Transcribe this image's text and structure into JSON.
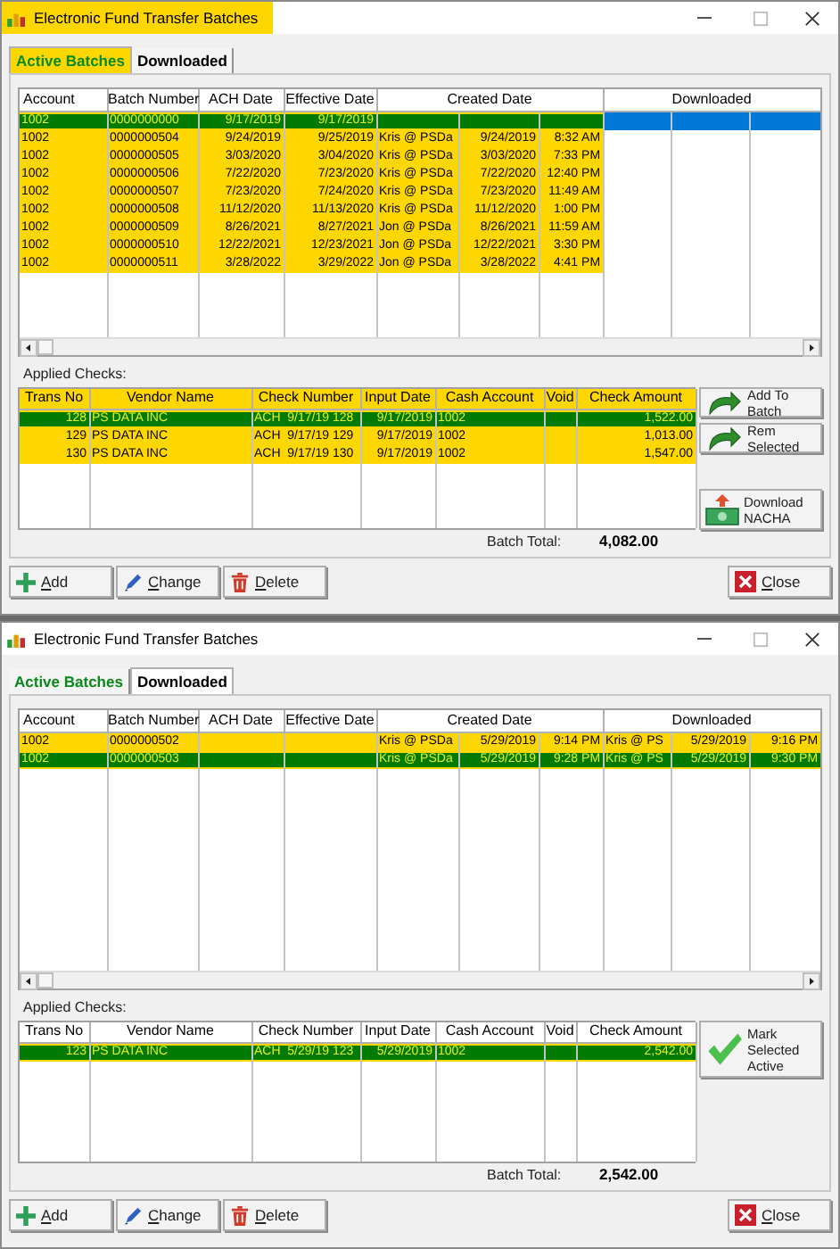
{
  "windows": [
    {
      "title": "Electronic Fund Transfer Batches",
      "title_highlighted": true,
      "tabs": [
        {
          "label": "Active Batches",
          "selected": true,
          "highlighted": true
        },
        {
          "label": "Downloaded",
          "selected": false,
          "highlighted": false
        }
      ],
      "batches": {
        "columns": [
          "Account",
          "Batch Number",
          "ACH Date",
          "Effective Date",
          "Created Date",
          "Downloaded"
        ],
        "rows": [
          {
            "selected": true,
            "highlighted": true,
            "account": "1002",
            "batch_number": "0000000000",
            "ach_date": "9/17/2019",
            "effective_date": "9/17/2019"
          },
          {
            "selected": false,
            "highlighted": true,
            "account": "1002",
            "batch_number": "0000000504",
            "ach_date": "9/24/2019",
            "effective_date": "9/25/2019",
            "created_by": "Kris @ PSDa",
            "created_date": "9/24/2019",
            "created_time": "8:32 AM"
          },
          {
            "selected": false,
            "highlighted": true,
            "account": "1002",
            "batch_number": "0000000505",
            "ach_date": "3/03/2020",
            "effective_date": "3/04/2020",
            "created_by": "Kris @ PSDa",
            "created_date": "3/03/2020",
            "created_time": "7:33 PM"
          },
          {
            "selected": false,
            "highlighted": true,
            "account": "1002",
            "batch_number": "0000000506",
            "ach_date": "7/22/2020",
            "effective_date": "7/23/2020",
            "created_by": "Kris @ PSDa",
            "created_date": "7/22/2020",
            "created_time": "12:40 PM"
          },
          {
            "selected": false,
            "highlighted": true,
            "account": "1002",
            "batch_number": "0000000507",
            "ach_date": "7/23/2020",
            "effective_date": "7/24/2020",
            "created_by": "Kris @ PSDa",
            "created_date": "7/23/2020",
            "created_time": "11:49 AM"
          },
          {
            "selected": false,
            "highlighted": true,
            "account": "1002",
            "batch_number": "0000000508",
            "ach_date": "11/12/2020",
            "effective_date": "11/13/2020",
            "created_by": "Kris @ PSDa",
            "created_date": "11/12/2020",
            "created_time": "1:00 PM"
          },
          {
            "selected": false,
            "highlighted": true,
            "account": "1002",
            "batch_number": "0000000509",
            "ach_date": "8/26/2021",
            "effective_date": "8/27/2021",
            "created_by": "Jon @ PSDa",
            "created_date": "8/26/2021",
            "created_time": "11:59 AM"
          },
          {
            "selected": false,
            "highlighted": true,
            "account": "1002",
            "batch_number": "0000000510",
            "ach_date": "12/22/2021",
            "effective_date": "12/23/2021",
            "created_by": "Jon @ PSDa",
            "created_date": "12/22/2021",
            "created_time": "3:30 PM"
          },
          {
            "selected": false,
            "highlighted": true,
            "account": "1002",
            "batch_number": "0000000511",
            "ach_date": "3/28/2022",
            "effective_date": "3/29/2022",
            "created_by": "Jon @ PSDa",
            "created_date": "3/28/2022",
            "created_time": "4:41 PM"
          }
        ]
      },
      "applied_checks": {
        "label": "Applied Checks:",
        "header_highlighted": true,
        "columns": [
          "Trans No",
          "Vendor Name",
          "Check Number",
          "Input Date",
          "Cash Account",
          "Void",
          "Check Amount"
        ],
        "rows": [
          {
            "selected": true,
            "highlighted": true,
            "trans_no": "128",
            "vendor": "PS DATA INC",
            "check_number": "ACH  9/17/19 128",
            "input_date": "9/17/2019",
            "cash_account": "1002",
            "amount": "1,522.00"
          },
          {
            "selected": false,
            "highlighted": true,
            "trans_no": "129",
            "vendor": "PS DATA INC",
            "check_number": "ACH  9/17/19 129",
            "input_date": "9/17/2019",
            "cash_account": "1002",
            "amount": "1,013.00"
          },
          {
            "selected": false,
            "highlighted": true,
            "trans_no": "130",
            "vendor": "PS DATA INC",
            "check_number": "ACH  9/17/19 130",
            "input_date": "9/17/2019",
            "cash_account": "1002",
            "amount": "1,547.00"
          }
        ]
      },
      "side_buttons": [
        {
          "label": "Add To Batch",
          "kind": "add"
        },
        {
          "label": "Rem Selected",
          "kind": "remove"
        },
        {
          "label": "Download NACHA",
          "kind": "download"
        }
      ],
      "batch_total": {
        "label": "Batch Total:",
        "value": "4,082.00"
      },
      "buttons": [
        {
          "label": "Add",
          "kind": "add"
        },
        {
          "label": "Change",
          "kind": "change"
        },
        {
          "label": "Delete",
          "kind": "delete"
        },
        {
          "label": "Close",
          "kind": "close"
        }
      ]
    },
    {
      "title": "Electronic Fund Transfer Batches",
      "title_highlighted": false,
      "tabs": [
        {
          "label": "Active Batches",
          "selected": false,
          "highlighted": false
        },
        {
          "label": "Downloaded",
          "selected": true,
          "highlighted": false
        }
      ],
      "batches": {
        "columns": [
          "Account",
          "Batch Number",
          "ACH Date",
          "Effective Date",
          "Created Date",
          "Downloaded"
        ],
        "rows": [
          {
            "selected": false,
            "highlighted": true,
            "account": "1002",
            "batch_number": "0000000502",
            "created_by": "Kris @ PSDa",
            "created_date": "5/29/2019",
            "created_time": "9:14 PM",
            "downloaded_by": "Kris @ PS",
            "downloaded_date": "5/29/2019",
            "downloaded_time": "9:16 PM"
          },
          {
            "selected": true,
            "highlighted": true,
            "account": "1002",
            "batch_number": "0000000503",
            "created_by": "Kris @ PSDa",
            "created_date": "5/29/2019",
            "created_time": "9:28 PM",
            "downloaded_by": "Kris @ PS",
            "downloaded_date": "5/29/2019",
            "downloaded_time": "9:30 PM"
          }
        ]
      },
      "applied_checks": {
        "label": "Applied Checks:",
        "header_highlighted": false,
        "columns": [
          "Trans No",
          "Vendor Name",
          "Check Number",
          "Input Date",
          "Cash Account",
          "Void",
          "Check Amount"
        ],
        "rows": [
          {
            "selected": true,
            "highlighted": true,
            "trans_no": "123",
            "vendor": "PS DATA INC",
            "check_number": "ACH  5/29/19 123",
            "input_date": "5/29/2019",
            "cash_account": "1002",
            "amount": "2,542.00"
          }
        ]
      },
      "side_buttons": [
        {
          "label": "Mark Selected Active",
          "kind": "mark"
        }
      ],
      "batch_total": {
        "label": "Batch Total:",
        "value": "2,542.00"
      },
      "buttons": [
        {
          "label": "Add",
          "kind": "add"
        },
        {
          "label": "Change",
          "kind": "change"
        },
        {
          "label": "Delete",
          "kind": "delete"
        },
        {
          "label": "Close",
          "kind": "close"
        }
      ]
    }
  ]
}
